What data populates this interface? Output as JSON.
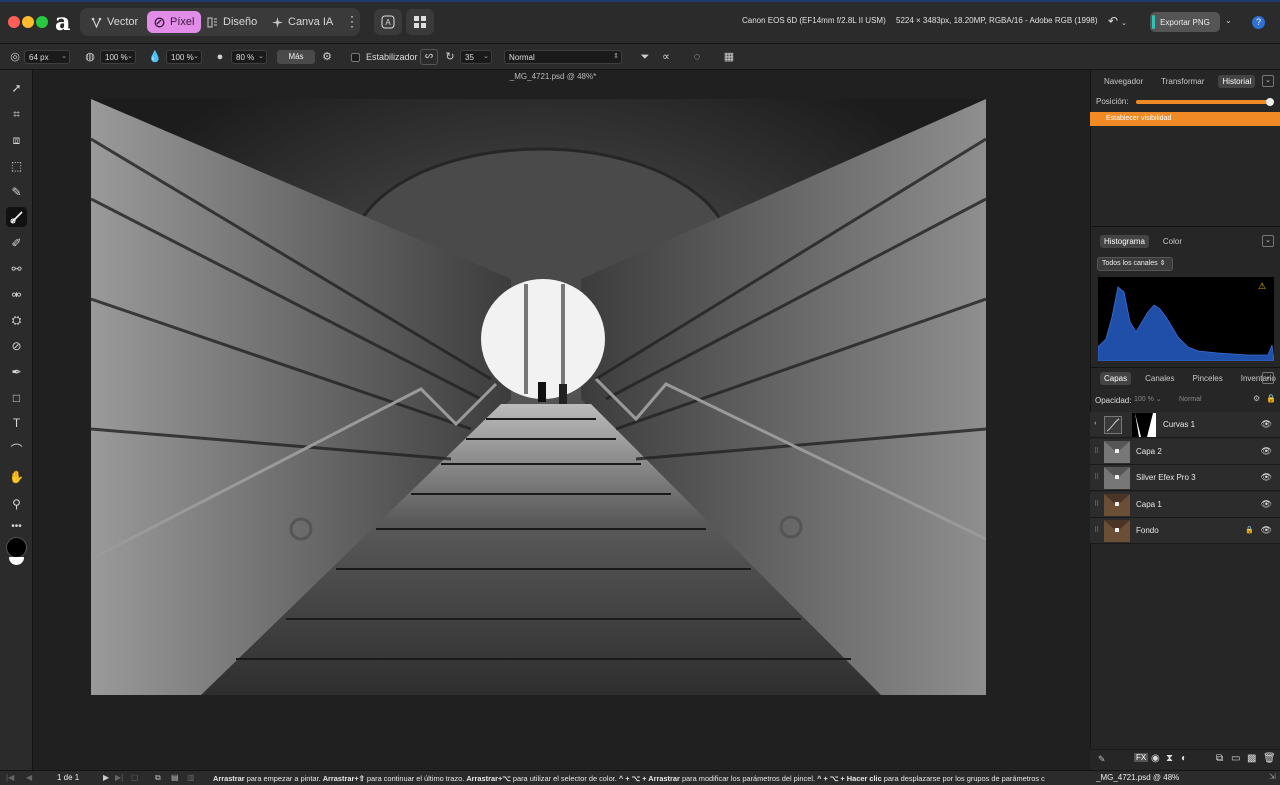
{
  "app": {
    "logo_char": "a"
  },
  "personas": [
    {
      "label": "Vector",
      "icon": "vector-persona-icon"
    },
    {
      "label": "Píxel",
      "icon": "pixel-persona-icon",
      "active": true
    },
    {
      "label": "Diseño",
      "icon": "layout-persona-icon"
    },
    {
      "label": "Canva IA",
      "icon": "sparkle-icon"
    }
  ],
  "topbar": {
    "camera": "Canon EOS 6D (EF14mm f/2.8L II USM)",
    "image_info": "5224 × 3483px, 18.20MP, RGBA/16 - Adobe RGB (1998)",
    "export_label": "Exportar PNG",
    "help": "?"
  },
  "context_bar": {
    "width": "64 px",
    "opacity": "100 %",
    "flow": "100 %",
    "hardness": "80 %",
    "more_label": "Más",
    "stabilizer_label": "Estabilizador",
    "stabilizer_value": "35",
    "blend_mode": "Normal"
  },
  "document": {
    "title": "_MG_4721.psd @ 48%*"
  },
  "history_panel": {
    "tabs": [
      "Navegador",
      "Transformar",
      "Historial"
    ],
    "active_tab": "Historial",
    "position_label": "Posición:",
    "selected_entry": "Establecer visibilidad"
  },
  "histogram_panel": {
    "tabs": [
      "Histograma",
      "Color"
    ],
    "active_tab": "Histograma",
    "channel": "Todos los canales"
  },
  "layers_panel": {
    "tabs": [
      "Capas",
      "Canales",
      "Pinceles",
      "Inventario"
    ],
    "active_tab": "Capas",
    "opacity_label": "Opacidad:",
    "opacity_value": "100 %",
    "blend_value": "Normal",
    "layers": [
      {
        "name": "Curvas 1"
      },
      {
        "name": "Capa 2"
      },
      {
        "name": "Silver Efex Pro 3"
      },
      {
        "name": "Capa 1"
      },
      {
        "name": "Fondo"
      }
    ]
  },
  "statusbar": {
    "page": "1 de 1",
    "hint_parts": [
      {
        "b": "Arrastrar",
        "t": " para empezar a pintar. "
      },
      {
        "b": "Arrastrar+⇧",
        "t": " para continuar el último trazo. "
      },
      {
        "b": "Arrastrar+⌥",
        "t": " para utilizar el selector de color. "
      },
      {
        "b": "^ + ⌥ + Arrastrar",
        "t": " para modificar los parámetros del pincel. "
      },
      {
        "b": "^ + ⌥ + Hacer clic",
        "t": " para desplazarse por los grupos de parámetros c"
      }
    ],
    "doc_status": "_MG_4721.psd @ 48%"
  },
  "colors": {
    "accent_pixel": "#e28ee8",
    "history_highlight": "#f08a24",
    "histogram": "#1f4fa8"
  }
}
